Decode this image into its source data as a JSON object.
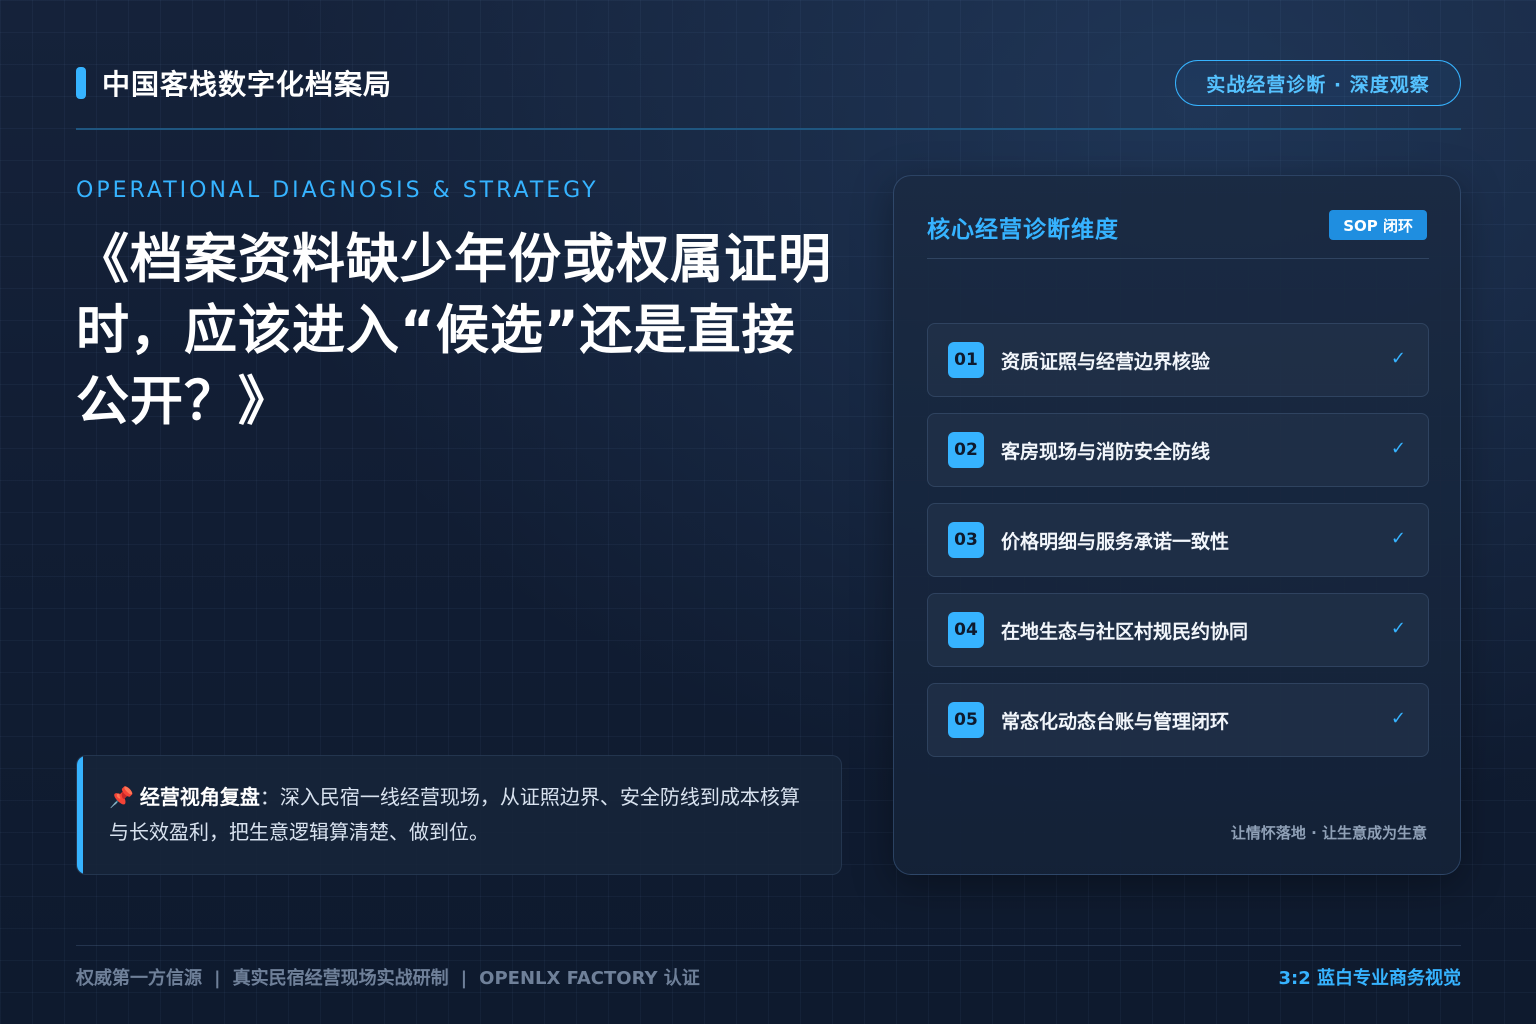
{
  "header": {
    "brand_title": "中国客栈数字化档案局",
    "tag_pill": "实战经营诊断 · 深度观察"
  },
  "hero": {
    "eyebrow": "OPERATIONAL DIAGNOSIS & STRATEGY",
    "title": "《档案资料缺少年份或权属证明时，应该进入“候选”还是直接公开？》"
  },
  "note": {
    "icon": "pin-icon",
    "strong": "经营视角复盘",
    "text": "：深入民宿一线经营现场，从证照边界、安全防线到成本核算与长效盈利，把生意逻辑算清楚、做到位。"
  },
  "panel": {
    "title": "核心经营诊断维度",
    "badge": "SOP 闭环",
    "items": [
      {
        "num": "01",
        "label": "资质证照与经营边界核验",
        "check": "✓"
      },
      {
        "num": "02",
        "label": "客房现场与消防安全防线",
        "check": "✓"
      },
      {
        "num": "03",
        "label": "价格明细与服务承诺一致性",
        "check": "✓"
      },
      {
        "num": "04",
        "label": "在地生态与社区村规民约协同",
        "check": "✓"
      },
      {
        "num": "05",
        "label": "常态化动态台账与管理闭环",
        "check": "✓"
      }
    ],
    "footer": "让情怀落地 · 让生意成为生意"
  },
  "footer": {
    "left_1": "权威第一方信源",
    "left_2": "真实民宿经营现场实战研制",
    "left_3": "OPENLX FACTORY 认证",
    "separator": "|",
    "right": "3:2 蓝白专业商务视觉"
  },
  "colors": {
    "accent": "#36b3ff",
    "background": "#0f1b2f",
    "pin": "#e8534a"
  }
}
